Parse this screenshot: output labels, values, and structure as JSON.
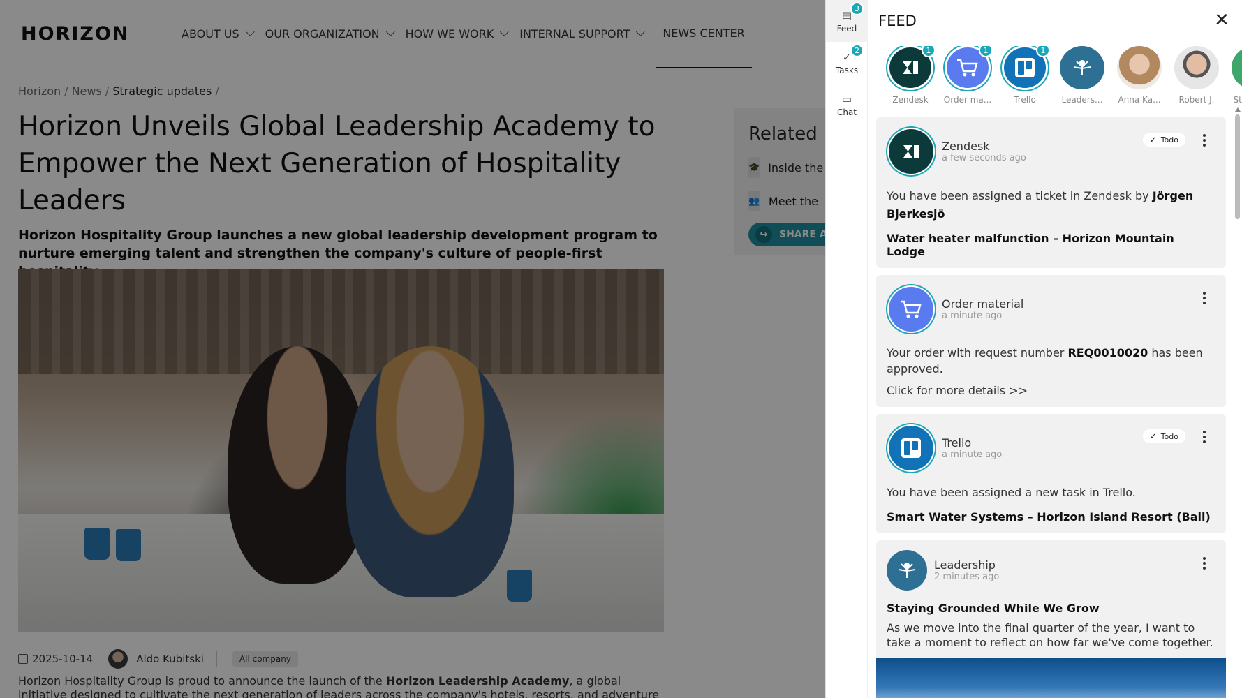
{
  "site": {
    "logo": "HORIZON",
    "nav": [
      {
        "label": "ABOUT US",
        "dropdown": true
      },
      {
        "label": "OUR ORGANIZATION",
        "dropdown": true
      },
      {
        "label": "HOW WE WORK",
        "dropdown": true
      },
      {
        "label": "INTERNAL SUPPORT",
        "dropdown": true
      },
      {
        "label": "NEWS CENTER",
        "dropdown": false,
        "active": true
      }
    ],
    "breadcrumb": [
      "Horizon",
      "News",
      "Strategic updates"
    ],
    "title": "Horizon Unveils Global Leadership Academy to Empower the Next Generation of Hospitality Leaders",
    "subtitle": "Horizon Hospitality Group launches a new global leadership development program to nurture emerging talent and strengthen the company's culture of people-first hospitality.",
    "date": "2025-10-14",
    "author": "Aldo Kubitski",
    "audience_tag": "All company",
    "body_start": "Horizon Hospitality Group is proud to announce the launch of the ",
    "body_bold": "Horizon Leadership Academy",
    "body_end": ", a global initiative designed to cultivate the next generation of leaders across the company's hotels, resorts, and adventure destinations.",
    "related": {
      "heading": "Related l",
      "items": [
        "Inside the",
        "Meet the"
      ],
      "share": "SHARE AF"
    }
  },
  "panel": {
    "rail": [
      {
        "label": "Feed",
        "badge": "3",
        "icon": "newspaper-icon",
        "active": true
      },
      {
        "label": "Tasks",
        "badge": "2",
        "icon": "check-icon",
        "active": false
      },
      {
        "label": "Chat",
        "badge": "",
        "icon": "chat-icon",
        "active": false
      }
    ],
    "title": "FEED",
    "strip": [
      {
        "label": "Zendesk",
        "badge": "1",
        "kind": "zendesk"
      },
      {
        "label": "Order ma...",
        "badge": "1",
        "kind": "order"
      },
      {
        "label": "Trello",
        "badge": "1",
        "kind": "trello"
      },
      {
        "label": "Leaders...",
        "badge": "",
        "kind": "leader"
      },
      {
        "label": "Anna Ka...",
        "badge": "",
        "kind": "anna"
      },
      {
        "label": "Robert J.",
        "badge": "",
        "kind": "robert"
      },
      {
        "label": "Strategi...",
        "badge": "",
        "kind": "strat"
      }
    ],
    "cards": {
      "zendesk": {
        "source": "Zendesk",
        "time": "a few seconds ago",
        "todo": "Todo",
        "text_pre": "You have been assigned a ticket in Zendesk by ",
        "text_bold": "Jörgen Bjerkesjö",
        "strong": "Water heater malfunction – Horizon Mountain Lodge"
      },
      "order": {
        "source": "Order material",
        "time": "a minute ago",
        "text_pre": "Your order with request number ",
        "text_bold": "REQ0010020",
        "text_post": " has been approved.",
        "link": "Click for more details >>"
      },
      "trello": {
        "source": "Trello",
        "time": "a minute ago",
        "todo": "Todo",
        "text": "You have been assigned a new task in Trello.",
        "strong": "Smart Water Systems – Horizon Island Resort (Bali)"
      },
      "leadership": {
        "source": "Leadership",
        "time": "2 minutes ago",
        "strong": "Staying Grounded While We Grow",
        "text": "As we move into the final quarter of the year, I want to take a moment to reflect on how far we've come together."
      }
    },
    "colors": {
      "accent": "#1aa8b6",
      "zendesk": "#0c3a3a",
      "order": "#5a7bf0",
      "trello": "#1172b8",
      "leadership": "#2e6f94"
    }
  }
}
